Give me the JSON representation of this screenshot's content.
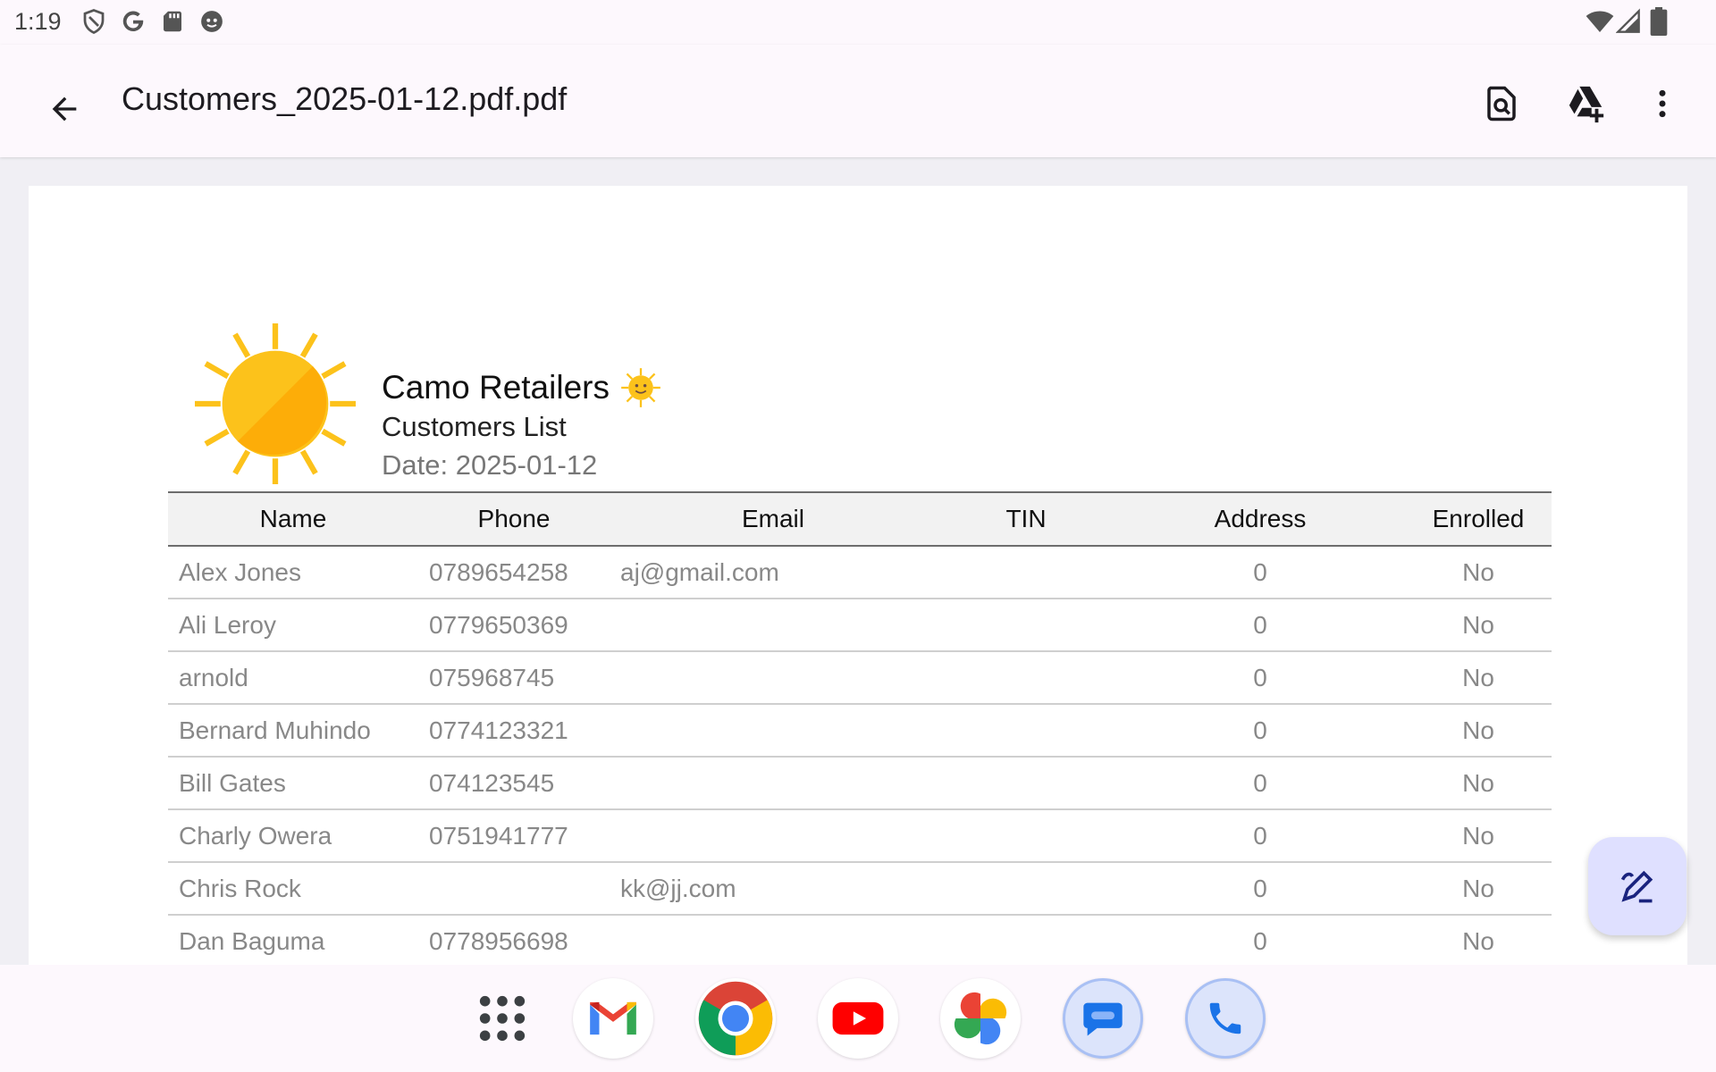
{
  "status_bar": {
    "time": "1:19",
    "left_icons": [
      "shield-icon",
      "google-icon",
      "sd-card-icon",
      "face-icon"
    ],
    "right_icons": [
      "wifi-icon",
      "cellular-signal-icon",
      "battery-icon"
    ]
  },
  "app_bar": {
    "title": "Customers_2025-01-12.pdf.pdf",
    "icons": [
      "back-arrow-icon",
      "find-in-page-icon",
      "add-to-drive-icon",
      "more-vert-icon"
    ]
  },
  "document": {
    "company": "Camo Retailers",
    "subtitle": "Customers List",
    "date": "Date: 2025-01-12",
    "table": {
      "headers": [
        "Name",
        "Phone",
        "Email",
        "TIN",
        "Address",
        "Enrolled"
      ],
      "rows": [
        [
          "Alex Jones",
          "0789654258",
          "aj@gmail.com",
          "",
          "0",
          "No"
        ],
        [
          "Ali Leroy",
          "0779650369",
          "",
          "",
          "0",
          "No"
        ],
        [
          "arnold",
          "075968745",
          "",
          "",
          "0",
          "No"
        ],
        [
          "Bernard Muhindo",
          "0774123321",
          "",
          "",
          "0",
          "No"
        ],
        [
          "Bill Gates",
          "074123545",
          "",
          "",
          "0",
          "No"
        ],
        [
          "Charly Owera",
          "0751941777",
          "",
          "",
          "0",
          "No"
        ],
        [
          "Chris Rock",
          "",
          "kk@jj.com",
          "",
          "0",
          "No"
        ],
        [
          "Dan Baguma",
          "0778956698",
          "",
          "",
          "0",
          "No"
        ]
      ]
    }
  },
  "fab": {
    "icon": "annotate-pen-icon"
  },
  "dock": {
    "apps": [
      "app-drawer-icon",
      "gmail-icon",
      "chrome-icon",
      "youtube-icon",
      "photos-icon",
      "messages-icon",
      "phone-icon"
    ]
  }
}
